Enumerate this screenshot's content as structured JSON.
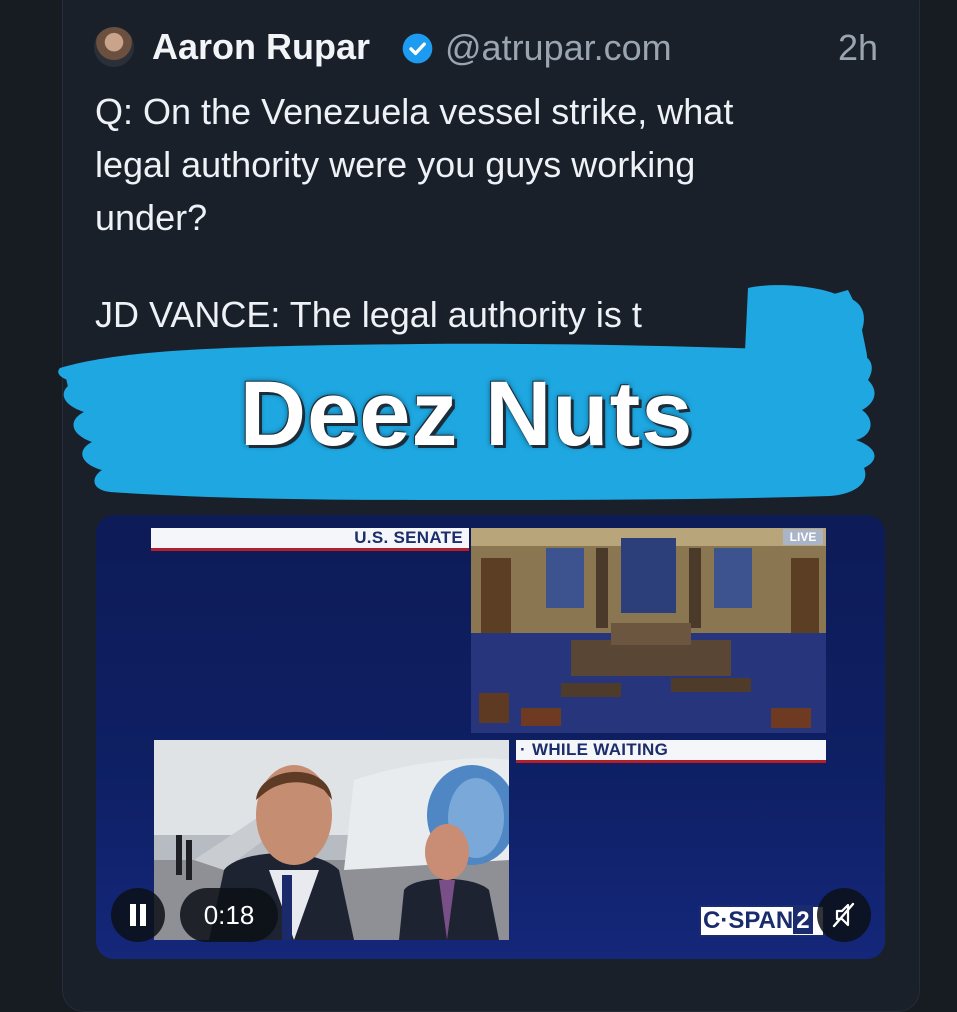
{
  "post": {
    "author_name": "Aaron Rupar",
    "handle": "@atrupar.com",
    "time": "2h",
    "question_text": "Q: On the Venezuela vessel strike, what\nlegal authority were you guys working\nunder?",
    "answer_text": "JD VANCE: The legal authority is t"
  },
  "overlay": {
    "meme_text": "Deez Nuts",
    "scribble_color": "#1ea7e1"
  },
  "video": {
    "senate_label": "U.S. SENATE",
    "live_label": "LIVE",
    "waiting_label": "WHILE WAITING",
    "timestamp": "0:18",
    "network_logo_text": "C·SPAN",
    "network_logo_num": "2",
    "playback_state": "playing",
    "muted": true
  },
  "colors": {
    "background": "#171c23",
    "accent_blue": "#1ea7e1",
    "verified": "#1d9bf0",
    "cspan_navy": "#1a2c6e"
  }
}
